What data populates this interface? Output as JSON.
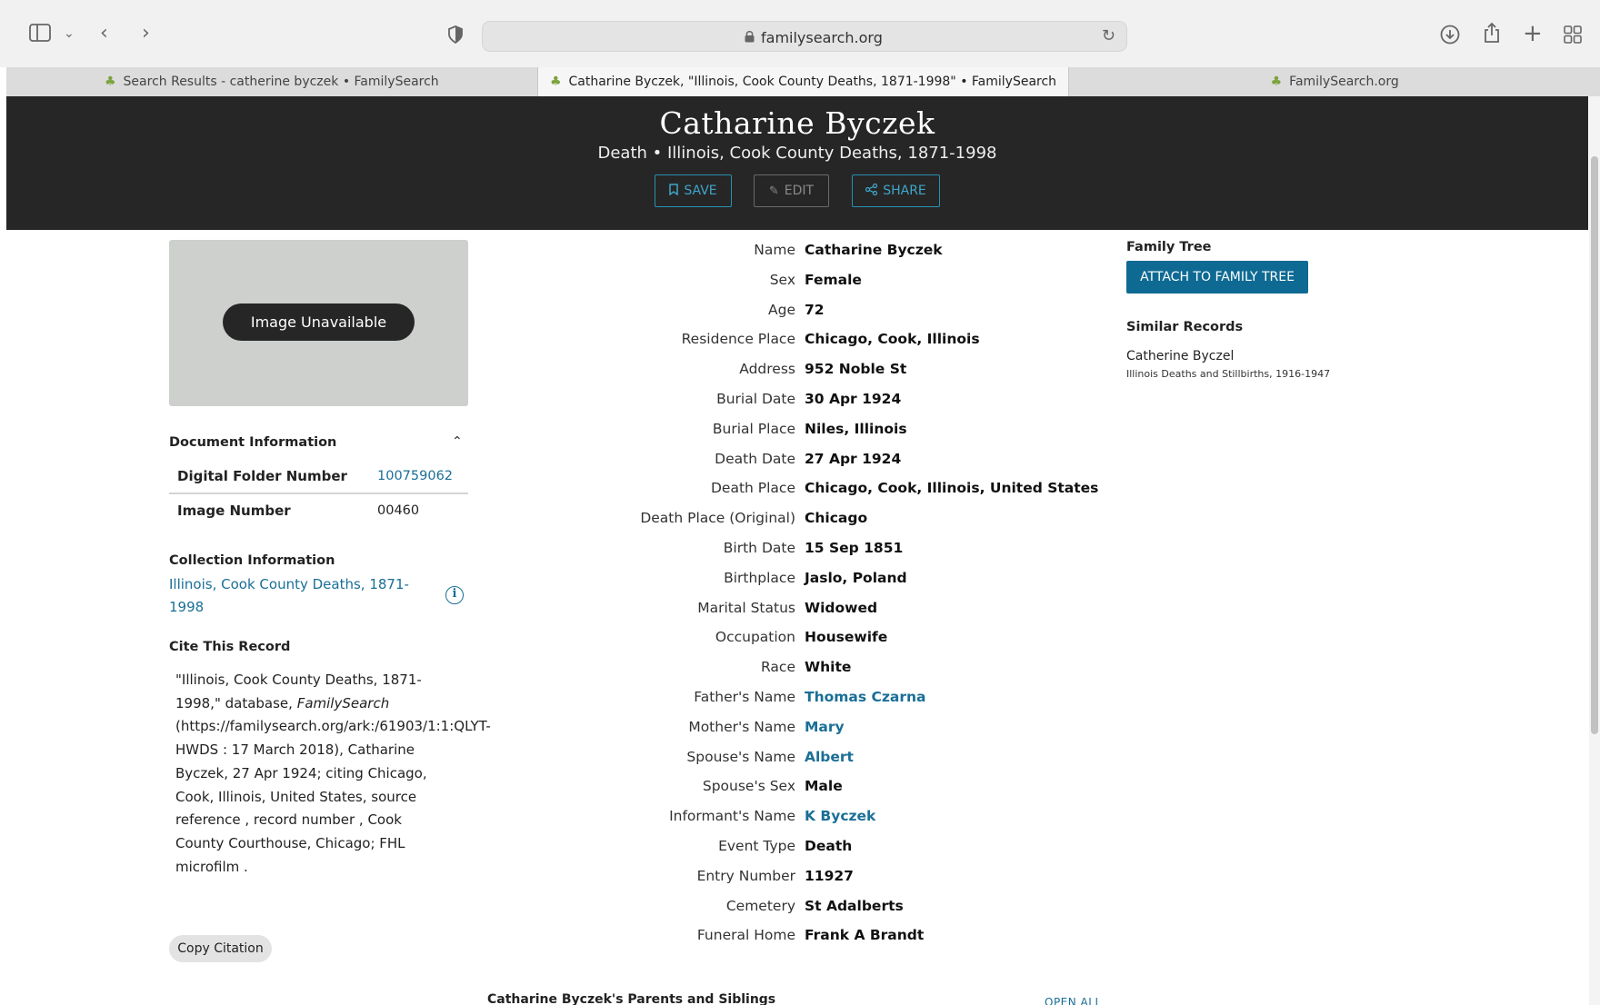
{
  "browser": {
    "url": "familysearch.org",
    "tabs": [
      {
        "label": "Search Results - catherine byczek • FamilySearch",
        "active": false
      },
      {
        "label": "Catharine Byczek, \"Illinois, Cook County Deaths, 1871-1998\" • FamilySearch",
        "active": true
      },
      {
        "label": "FamilySearch.org",
        "active": false
      }
    ]
  },
  "header": {
    "title": "Catharine Byczek",
    "subtitle": "Death • Illinois, Cook County Deaths, 1871-1998",
    "save_label": "SAVE",
    "edit_label": "EDIT",
    "share_label": "SHARE"
  },
  "image": {
    "label": "Image Unavailable"
  },
  "document_info": {
    "title": "Document Information",
    "rows": [
      {
        "label": "Digital Folder Number",
        "value": "100759062"
      },
      {
        "label": "Image Number",
        "value": "00460"
      }
    ]
  },
  "collection_info": {
    "title": "Collection Information",
    "link": "Illinois, Cook County Deaths, 1871-1998"
  },
  "cite": {
    "title": "Cite This Record",
    "text": "\"Illinois, Cook County Deaths, 1871-1998,\" database, FamilySearch (https://familysearch.org/ark:/61903/1:1:QLYT-HWDS : 17 March 2018), Catharine Byczek, 27 Apr 1924; citing Chicago, Cook, Illinois, United States, source reference , record number , Cook County Courthouse, Chicago; FHL microfilm .",
    "copy_label": "Copy Citation"
  },
  "facts": [
    {
      "label": "Name",
      "value": "Catharine Byczek",
      "link": false
    },
    {
      "label": "Sex",
      "value": "Female",
      "link": false
    },
    {
      "label": "Age",
      "value": "72",
      "link": false
    },
    {
      "label": "Residence Place",
      "value": "Chicago, Cook, Illinois",
      "link": false
    },
    {
      "label": "Address",
      "value": "952 Noble St",
      "link": false
    },
    {
      "label": "Burial Date",
      "value": "30 Apr 1924",
      "link": false
    },
    {
      "label": "Burial Place",
      "value": "Niles, Illinois",
      "link": false
    },
    {
      "label": "Death Date",
      "value": "27 Apr 1924",
      "link": false
    },
    {
      "label": "Death Place",
      "value": "Chicago, Cook, Illinois, United States",
      "link": false
    },
    {
      "label": "Death Place (Original)",
      "value": "Chicago",
      "link": false
    },
    {
      "label": "Birth Date",
      "value": "15 Sep 1851",
      "link": false
    },
    {
      "label": "Birthplace",
      "value": "Jaslo, Poland",
      "link": false
    },
    {
      "label": "Marital Status",
      "value": "Widowed",
      "link": false
    },
    {
      "label": "Occupation",
      "value": "Housewife",
      "link": false
    },
    {
      "label": "Race",
      "value": "White",
      "link": false
    },
    {
      "label": "Father's Name",
      "value": "Thomas Czarna",
      "link": true
    },
    {
      "label": "Mother's Name",
      "value": "Mary",
      "link": true
    },
    {
      "label": "Spouse's Name",
      "value": "Albert",
      "link": true
    },
    {
      "label": "Spouse's Sex",
      "value": "Male",
      "link": false
    },
    {
      "label": "Informant's Name",
      "value": "K Byczek",
      "link": true
    },
    {
      "label": "Event Type",
      "value": "Death",
      "link": false
    },
    {
      "label": "Entry Number",
      "value": "11927",
      "link": false
    },
    {
      "label": "Cemetery",
      "value": "St Adalberts",
      "link": false
    },
    {
      "label": "Funeral Home",
      "value": "Frank A Brandt",
      "link": false
    }
  ],
  "parents_section": {
    "title": "Catharine Byczek's Parents and Siblings",
    "open_all": "OPEN ALL"
  },
  "family_tree": {
    "title": "Family Tree",
    "attach_label": "ATTACH TO FAMILY TREE"
  },
  "similar_records": {
    "title": "Similar Records",
    "items": [
      {
        "name": "Catherine Byczel",
        "collection": "Illinois Deaths and Stillbirths, 1916-1947"
      }
    ]
  }
}
